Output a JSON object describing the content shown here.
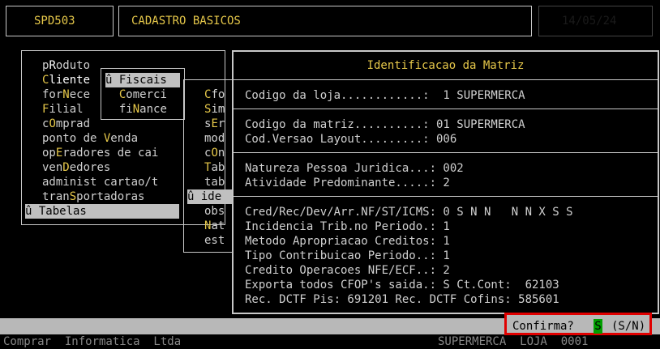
{
  "header": {
    "program_code": "SPD503",
    "screen_title": "CADASTRO BASICOS",
    "box3_text": "",
    "box4_text": "14/05/24"
  },
  "main_menu": {
    "items": [
      {
        "label": "pRoduto",
        "hot": "R"
      },
      {
        "label": "Cliente",
        "hot": "C"
      },
      {
        "label": "forNece",
        "hot": "N"
      },
      {
        "label": "Filial",
        "hot": "F"
      },
      {
        "label": "cOmprad",
        "hot": "O"
      },
      {
        "label": "ponto de Venda",
        "hot": "V"
      },
      {
        "label": "opEradores de cai",
        "hot": "E"
      },
      {
        "label": "venDedores",
        "hot": "D"
      },
      {
        "label": "administ cartao/t",
        "hot": ""
      },
      {
        "label": "tranSportadoras",
        "hot": "S"
      },
      {
        "label": "û Tabelas",
        "hot": "",
        "selected": true
      }
    ]
  },
  "submenu_fiscais": {
    "items": [
      {
        "label": "û Fiscais",
        "selected": true
      },
      {
        "label": "  Comerci"
      },
      {
        "label": "  fiNance"
      }
    ]
  },
  "submenu_tables": {
    "items": [
      {
        "label": "Cfo"
      },
      {
        "label": "Sim"
      },
      {
        "label": "sEr"
      },
      {
        "label": "mod"
      },
      {
        "label": "cOn"
      },
      {
        "label": "Tab"
      },
      {
        "label": "tab"
      },
      {
        "label": "û ide",
        "selected": true
      },
      {
        "label": "obs"
      },
      {
        "label": "Nat"
      },
      {
        "label": "est"
      }
    ]
  },
  "dialog": {
    "title": "Identificacao da Matriz",
    "section1": [
      "Codigo da loja............:  1 SUPERMERCA"
    ],
    "section2": [
      "Codigo da matriz..........: 01 SUPERMERCA",
      "Cod.Versao Layout.........: 006"
    ],
    "section3": [
      "Natureza Pessoa Juridica...: 002",
      "Atividade Predominante.....: 2"
    ],
    "section4": [
      "Cred/Rec/Dev/Arr.NF/ST/ICMS: 0 S N N   N N X S S",
      "Incidencia Trib.no Periodo.: 1",
      "Metodo Apropriacao Creditos: 1",
      "Tipo Contribuicao Periodo..: 1",
      "Credito Operacoes NFE/ECF..: 2",
      "Exporta todos CFOP's saida.: S Ct.Cont:  62103",
      "Rec. DCTF Pis: 691201 Rec. DCTF Cofins: 585601"
    ]
  },
  "confirm": {
    "label": "Confirma?",
    "value": "S",
    "options": "(S/N)"
  },
  "footer": {
    "left_text": "Comprar  Informatica  Ltda",
    "right_text": "SUPERMERCA  LOJA  0001"
  },
  "colors": {
    "background": "#000000",
    "header_text": "#e6c84a",
    "highlight_border": "#e00000",
    "confirm_value_bg": "#00a000"
  }
}
